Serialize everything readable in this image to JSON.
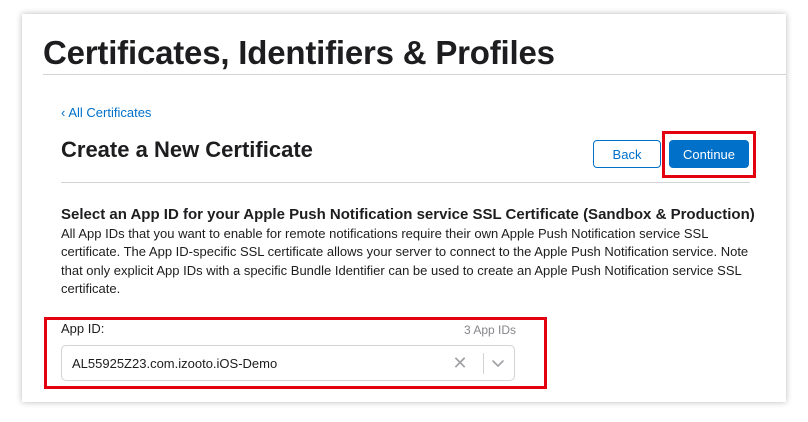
{
  "page": {
    "title": "Certificates, Identifiers & Profiles"
  },
  "breadcrumb": {
    "chevron": "‹",
    "label": "All Certificates"
  },
  "header": {
    "title": "Create a New Certificate",
    "back_label": "Back",
    "continue_label": "Continue"
  },
  "description": {
    "title": "Select an App ID for your Apple Push Notification service SSL Certificate (Sandbox & Production)",
    "body": "All App IDs that you want to enable for remote notifications require their own Apple Push Notification service SSL certificate. The App ID-specific SSL certificate allows your server to connect to the Apple Push Notification service. Note that only explicit App IDs with a specific Bundle Identifier can be used to create an Apple Push Notification service SSL certificate."
  },
  "app_id_field": {
    "label": "App ID:",
    "count": "3 App IDs",
    "selected_value": "AL55925Z23.com.izooto.iOS-Demo",
    "clear_glyph": "✕"
  },
  "icons": {
    "clear": "clear-icon",
    "chevron": "chevron-down-icon"
  },
  "colors": {
    "accent": "#0070c9",
    "highlight": "#e3000f",
    "text": "#1d1d1f",
    "muted": "#86868b",
    "border": "#d2d2d7"
  }
}
